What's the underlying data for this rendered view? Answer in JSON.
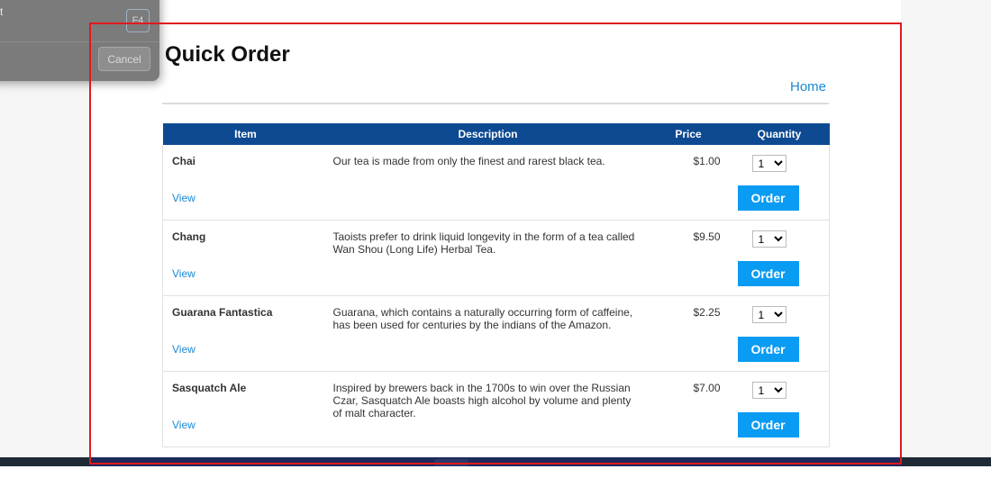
{
  "dialog": {
    "row_text": "t",
    "shortcut_key": "F4",
    "cancel_label": "Cancel"
  },
  "page": {
    "title": "Quick Order",
    "home_link": "Home"
  },
  "table": {
    "headers": [
      "Item",
      "Description",
      "Price",
      "Quantity"
    ],
    "view_label": "View",
    "order_label": "Order",
    "rows": [
      {
        "name": "Chai",
        "description": "Our tea is made from only the finest and rarest black tea.",
        "price": "$1.00",
        "quantity": "1"
      },
      {
        "name": "Chang",
        "description": "Taoists prefer to drink liquid longevity in the form of a tea called Wan Shou (Long Life) Herbal Tea.",
        "price": "$9.50",
        "quantity": "1"
      },
      {
        "name": "Guarana Fantastica",
        "description": "Guarana, which contains a naturally occurring form of caffeine, has been used for centuries by the indians of the Amazon.",
        "price": "$2.25",
        "quantity": "1"
      },
      {
        "name": "Sasquatch Ale",
        "description": "Inspired by brewers back in the 1700s to win over the Russian Czar, Sasquatch Ale boasts high alcohol by volume and plenty of malt character.",
        "price": "$7.00",
        "quantity": "1"
      }
    ]
  },
  "colors": {
    "header_bg": "#0e4a92",
    "link": "#1a8ad4",
    "order_button": "#0a9bf3",
    "selection_outline": "#e0191d"
  }
}
